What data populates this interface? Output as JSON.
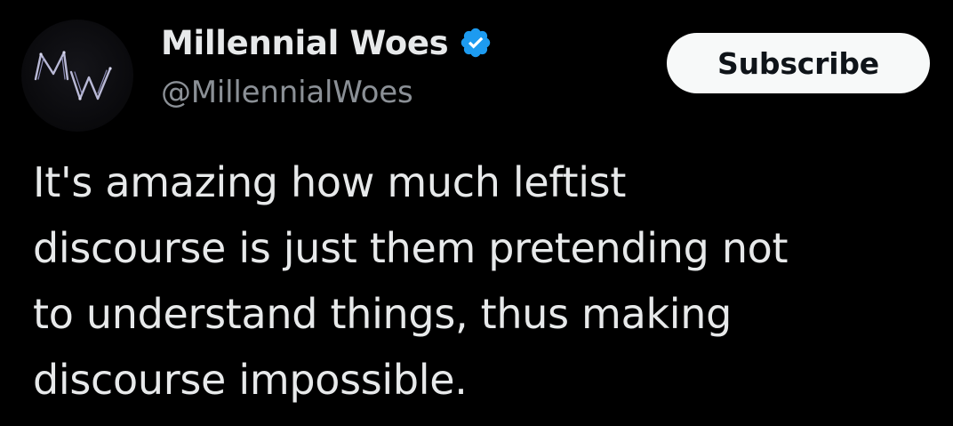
{
  "author": {
    "display_name": "Millennial Woes",
    "handle": "@MillennialWoes",
    "avatar_icon": "mw-monogram-avatar",
    "verified_icon": "verified-badge-icon",
    "verified_color": "#1d9bf0"
  },
  "actions": {
    "subscribe_label": "Subscribe"
  },
  "tweet": {
    "lines": [
      "It's amazing how much leftist",
      "discourse is just them pretending not",
      "to understand things, thus making",
      "discourse impossible."
    ]
  },
  "colors": {
    "background": "#000000",
    "text_primary": "#e7e9ea",
    "text_secondary": "#8b9096",
    "button_bg": "#f7f9f9",
    "button_text": "#0f1419"
  }
}
